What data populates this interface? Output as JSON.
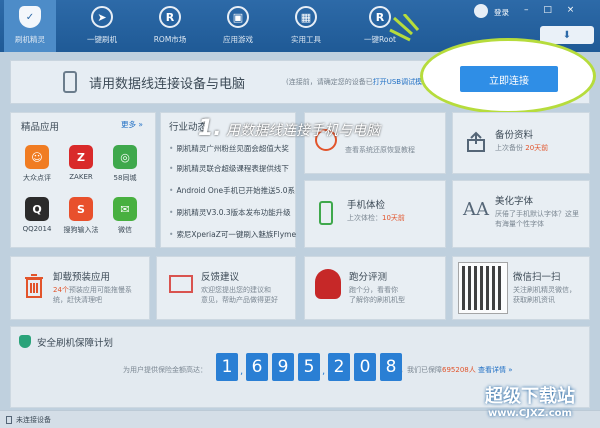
{
  "nav": {
    "items": [
      {
        "label": "刷机精灵",
        "glyph": "✓",
        "icon": "shield-icon"
      },
      {
        "label": "一键刷机",
        "glyph": "➤",
        "icon": "rocket-icon"
      },
      {
        "label": "ROM市场",
        "glyph": "R",
        "icon": "rom-icon"
      },
      {
        "label": "应用游戏",
        "glyph": "▣",
        "icon": "apps-icon"
      },
      {
        "label": "实用工具",
        "glyph": "▦",
        "icon": "toolbox-icon"
      },
      {
        "label": "一键Root",
        "glyph": "R",
        "icon": "root-icon"
      }
    ],
    "login": "登录",
    "window_controls": "– □ ×",
    "download_icon": "download-icon"
  },
  "banner": {
    "title": "请用数据线连接设备与电脑",
    "note": "(连接前，请确定您的设备已",
    "note_link": "打开USB调试模式",
    "note_end": ")",
    "connect_label": "立即连接"
  },
  "caption": {
    "number": "1.",
    "text": "用数据线连接手机与电脑"
  },
  "apps_card": {
    "title": "精品应用",
    "more": "更多 »",
    "apps": [
      {
        "label": "大众点评",
        "color": "#f07c22",
        "glyph": "☺"
      },
      {
        "label": "ZAKER",
        "color": "#d92a2a",
        "glyph": "Z"
      },
      {
        "label": "58同城",
        "color": "#3fa84c",
        "glyph": "◎"
      },
      {
        "label": "QQ2014",
        "color": "#2b2b2b",
        "glyph": "Q"
      },
      {
        "label": "搜狗输入法",
        "color": "#e8502c",
        "glyph": "S"
      },
      {
        "label": "微信",
        "color": "#48b040",
        "glyph": "✉"
      }
    ]
  },
  "news_card": {
    "title": "行业动态",
    "items": [
      "刷机精灵广州粉丝见面会超值大奖",
      "刷机精灵联合超级课程表提供线下",
      "Android One手机已开始推送5.0系",
      "刷机精灵V3.0.3版本发布功能升级",
      "索尼XperiaZ可一键刷入魅族Flyme"
    ]
  },
  "tiles": {
    "backup": {
      "title": "备份资料",
      "sub": "上次备份",
      "value": "20天前"
    },
    "check_top": {
      "sub": "查看系统还原恢复教程"
    },
    "phone_check": {
      "title": "手机体检",
      "sub": "上次体检：",
      "value": "10天前"
    },
    "fonts": {
      "title": "美化字体",
      "sub1": "厌倦了手机默认字体？这里",
      "sub2": "有海量个性字体"
    },
    "uninstall": {
      "title": "卸载预装应用",
      "sub1_hl": "24个",
      "sub1": "预装应用可能拖慢系",
      "sub2": "统，赶快清理吧"
    },
    "feedback": {
      "title": "反馈建议",
      "sub1": "欢迎您提出您的建议和",
      "sub2": "意见，帮助产品做得更好"
    },
    "benchmark": {
      "title": "跑分评测",
      "sub1": "跑个分，看看你",
      "sub2": "了解你的刷机机型"
    },
    "wechat": {
      "title": "微信扫一扫",
      "sub1": "关注刷机精灵微信，",
      "sub2": "获取刷机资讯"
    }
  },
  "guarantee": {
    "title": "安全刷机保障计划",
    "prefix": "为用户提供保险金额高达：",
    "digits": [
      "1",
      "6",
      "9",
      "5",
      "2",
      "0",
      "8"
    ],
    "suffix": "元，我们已保障",
    "count": "695208人",
    "link": "查看详情 »"
  },
  "status": {
    "text": "未连接设备"
  },
  "watermark": {
    "line1": "超级下载站",
    "line2": "www.CJXZ.com"
  }
}
